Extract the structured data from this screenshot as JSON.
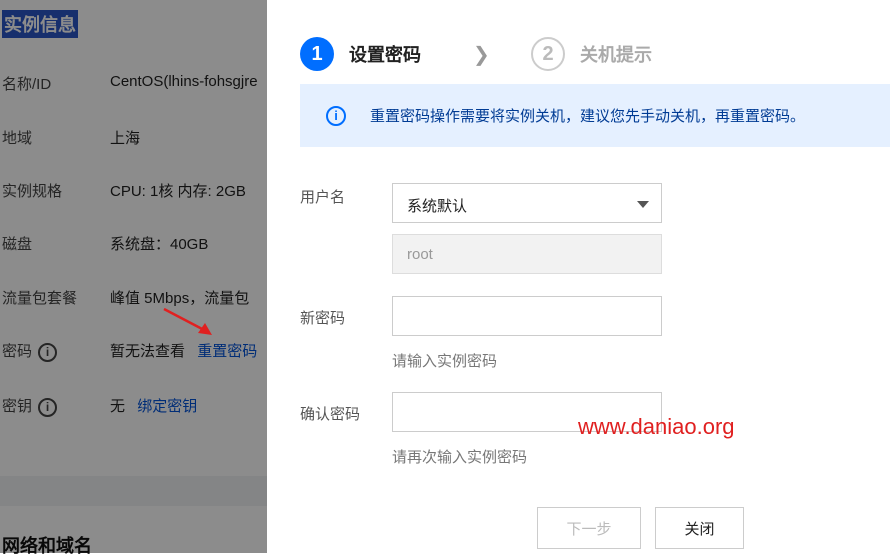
{
  "background": {
    "section_title": "实例信息",
    "rows": [
      {
        "label": "名称/ID",
        "value": "CentOS(lhins-fohsgjre"
      },
      {
        "label": "地域",
        "value": "上海"
      },
      {
        "label": "实例规格",
        "value": "CPU: 1核 内存: 2GB"
      },
      {
        "label": "磁盘",
        "value": "系统盘：40GB"
      },
      {
        "label": "流量包套餐",
        "value": "峰值 5Mbps，流量包"
      },
      {
        "label": "密码",
        "value": "暂无法查看",
        "link": "重置密码"
      },
      {
        "label": "密钥",
        "value": "无",
        "link": "绑定密钥"
      }
    ],
    "section_title2": "网络和域名"
  },
  "dialog": {
    "steps": [
      {
        "number": "1",
        "label": "设置密码"
      },
      {
        "number": "2",
        "label": "关机提示"
      }
    ],
    "alert": "重置密码操作需要将实例关机，建议您先手动关机，再重置密码。",
    "username_label": "用户名",
    "username_select": "系统默认",
    "username_value": "root",
    "new_password_label": "新密码",
    "new_password_hint": "请输入实例密码",
    "confirm_password_label": "确认密码",
    "confirm_password_hint": "请再次输入实例密码",
    "next_button": "下一步",
    "close_button": "关闭"
  },
  "watermark": "www.daniao.org",
  "colors": {
    "primary": "#006eff",
    "alert_bg": "#e5f0ff",
    "watermark": "#e02020"
  }
}
